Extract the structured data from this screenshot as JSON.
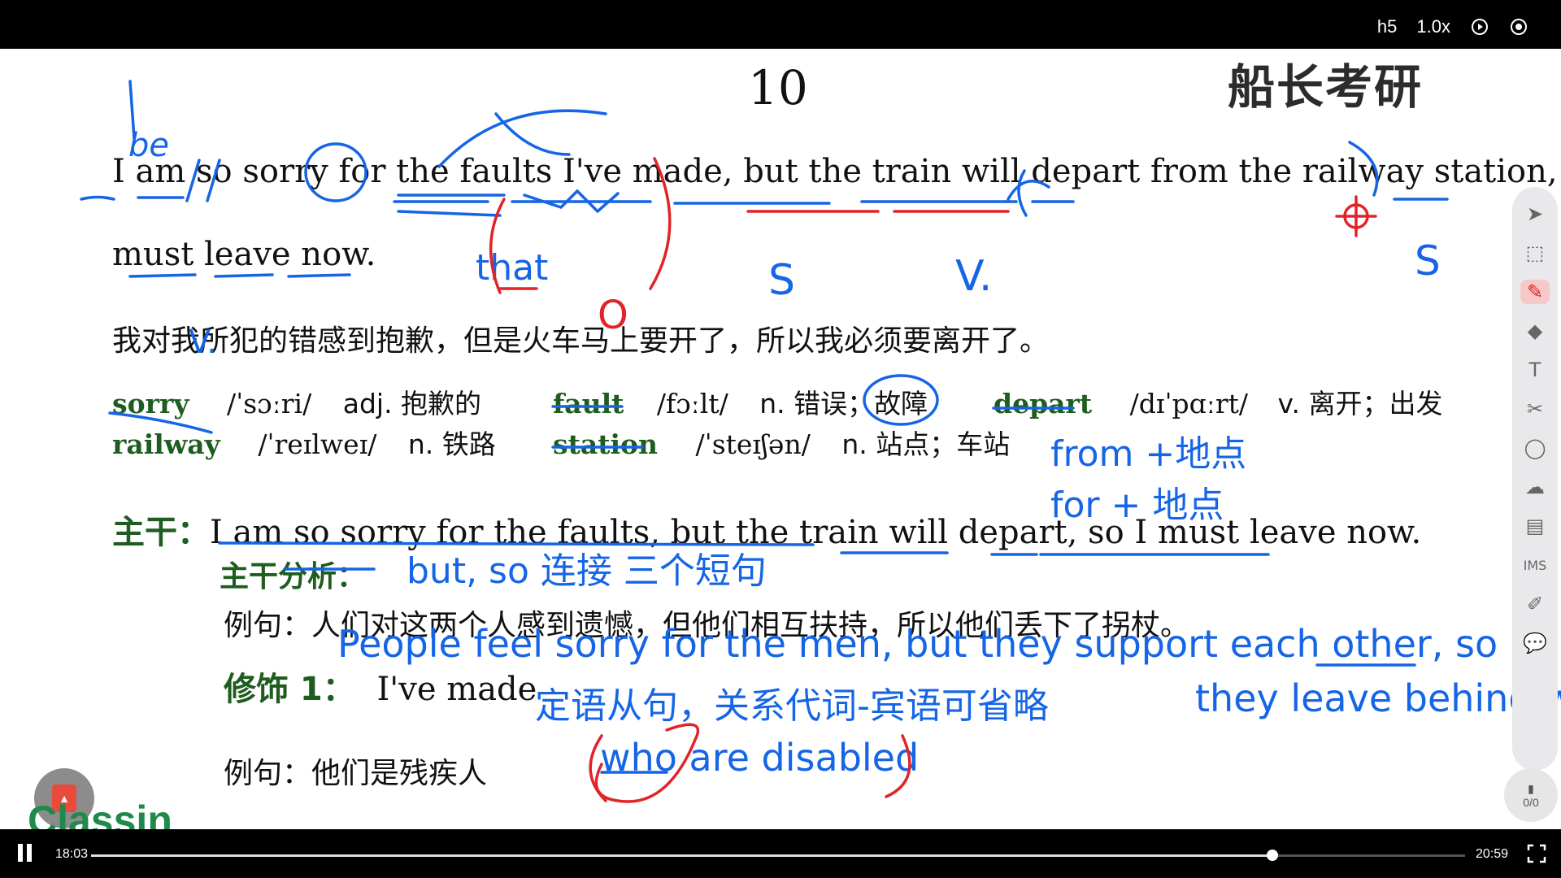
{
  "player": {
    "stream": "h5",
    "speed": "1.0x",
    "current_time": "18:03",
    "duration": "20:59",
    "progress": 0.86
  },
  "slide": {
    "page_number": "10",
    "brand": "船长考研",
    "sentence_line1": "I am so sorry for the faults I've made, but the train will depart from the railway station, so I",
    "sentence_line2": "must leave now.",
    "translation": "我对我所犯的错感到抱歉，但是火车马上要开了，所以我必须要离开了。",
    "vocab": [
      {
        "word": "sorry",
        "phonetic": "/ˈsɔːri/",
        "meaning": "adj.  抱歉的"
      },
      {
        "word": "fault",
        "phonetic": "/fɔːlt/",
        "meaning": "n.  错误；故障"
      },
      {
        "word": "depart",
        "phonetic": "/dɪˈpɑːrt/",
        "meaning": "v.  离开；出发"
      },
      {
        "word": "railway",
        "phonetic": "/ˈreɪlweɪ/",
        "meaning": "n.  铁路"
      },
      {
        "word": "station",
        "phonetic": "/ˈsteɪʃən/",
        "meaning": "n.  站点；车站"
      }
    ],
    "trunk_label": "主干：",
    "trunk_text": "I am so sorry for the faults, but the train will depart, so I must leave now.",
    "trunk_analysis_label": "主干分析：",
    "example_label_1": "例句：",
    "example_text_1": "人们对这两个人感到遗憾，但他们相互扶持，所以他们丢下了拐杖。",
    "modifier_label": "修饰 1：",
    "modifier_text": "I've made",
    "example_label_2": "例句：",
    "example_text_2": "他们是残疾人"
  },
  "handwriting": {
    "be": "be",
    "that": "that",
    "from_place": "from +地点",
    "for_place": "for + 地点",
    "but_so": "but, so 连接 三个短句",
    "people_feel": "People feel sorry for the men, but they support each other, so",
    "they_leave": "they leave behind wa",
    "relative_clause": "定语从句，关系代词-宾语可省略",
    "who_are_disabled": "who are disabled",
    "s1": "S",
    "v1": "V.",
    "v2": "V.",
    "s2": "S",
    "o1": "O"
  },
  "toolbar": {
    "items": [
      "pointer-icon",
      "select-icon",
      "pen-icon",
      "eraser-icon",
      "text-icon",
      "scissors-icon",
      "shape-icon",
      "cloud-icon",
      "toolbox-icon",
      "ims-icon",
      "edit-icon",
      "chat-icon"
    ],
    "ims_label": "IMS",
    "page_counter": "0/0"
  },
  "overlay": {
    "classin_label": "Classin"
  },
  "colors": {
    "ink_blue": "#1565e6",
    "ink_red": "#e0242a",
    "vocab_green": "#1f5c1f"
  }
}
